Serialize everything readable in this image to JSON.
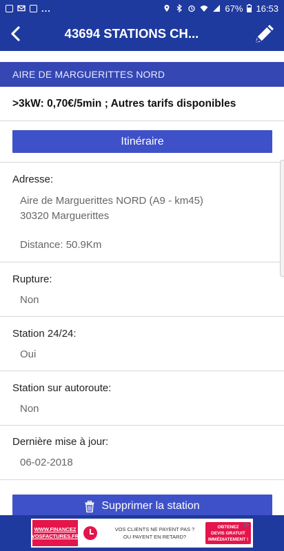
{
  "status_bar": {
    "notification_dots": "...",
    "battery": "67%",
    "time": "16:53"
  },
  "app_bar": {
    "title": "43694 STATIONS CH..."
  },
  "section_header": "AIRE DE MARGUERITTES NORD",
  "tarif": ">3kW: 0,70€/5min ; Autres tarifs disponibles",
  "itinerary_button": "Itinéraire",
  "fields": {
    "adresse": {
      "label": "Adresse:",
      "line1": "Aire de Marguerittes NORD (A9 - km45)",
      "line2": "30320 Marguerittes",
      "distance": "Distance: 50.9Km"
    },
    "rupture": {
      "label": "Rupture:",
      "value": "Non"
    },
    "station_24": {
      "label": "Station 24/24:",
      "value": "Oui"
    },
    "autoroute": {
      "label": "Station sur autoroute:",
      "value": "Non"
    },
    "maj": {
      "label": "Dernière mise à jour:",
      "value": "06-02-2018"
    }
  },
  "delete_button": "Supprimer la station",
  "ad": {
    "brand_line1": "WWW.FINANCEZ",
    "brand_line2": "VOSFACTURES.FR",
    "text_line1": "VOS CLIENTS NE PAYENT PAS ?",
    "text_line2": "OU PAYENT EN RETARD?",
    "cta_line1": "OBTENEZ",
    "cta_line2": "DEVIS GRATUIT",
    "cta_line3": "IMMÉDIATEMENT !"
  },
  "colors": {
    "app_bar": "#1f3a9e",
    "section_header": "#3547b3",
    "button": "#3f51c9",
    "ad_accent": "#e4154b"
  },
  "icons": [
    "image-icon",
    "mail-icon",
    "gallery-icon",
    "location-icon",
    "bluetooth-icon",
    "alarm-icon",
    "wifi-icon",
    "signal-icon",
    "battery-icon",
    "back-arrow-icon",
    "pencil-icon",
    "trash-icon",
    "clock-icon",
    "ad-choices-icon"
  ]
}
